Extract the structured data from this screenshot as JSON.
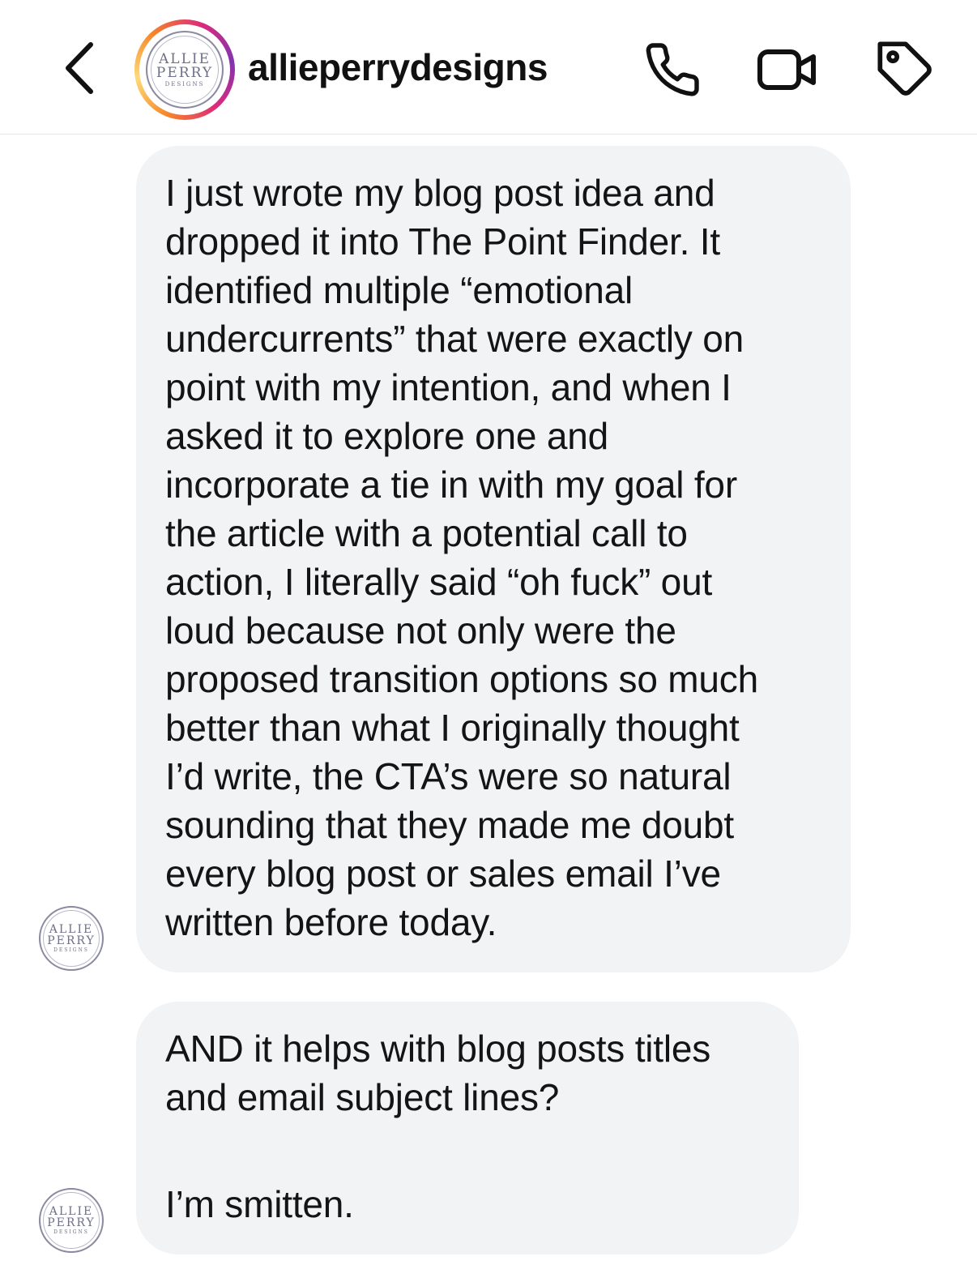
{
  "header": {
    "username": "allieperrydesigns",
    "avatar_logo": [
      "ALLIE",
      "PERRY",
      "DESIGNS"
    ],
    "icons": {
      "back": "chevron-left-icon",
      "call": "phone-icon",
      "video": "video-camera-icon",
      "tag": "tag-icon"
    },
    "story_ring_colors": [
      "#f58529",
      "#feda77",
      "#dd2a7b",
      "#8134af"
    ]
  },
  "messages": [
    {
      "lines": [
        "I just wrote my blog post idea and",
        "dropped it into The Point Finder. It",
        "identified multiple “emotional",
        "undercurrents” that were exactly on",
        "point with my intention, and when I",
        "asked it to explore one and",
        "incorporate a tie in with my goal for",
        "the article with a potential call to",
        "action, I literally said “oh fuck” out",
        "loud because not only were the",
        "proposed transition options so much",
        "better than what I originally thought",
        "I’d write, the CTA’s were so natural",
        "sounding that they made me doubt",
        "every blog post or sales email I’ve",
        "written before today."
      ]
    },
    {
      "lines": [
        "AND it helps with blog posts titles",
        "and email subject lines?"
      ],
      "after_gap": "I’m smitten."
    }
  ],
  "colors": {
    "bubble_bg": "#f2f3f5",
    "text": "#141414"
  }
}
